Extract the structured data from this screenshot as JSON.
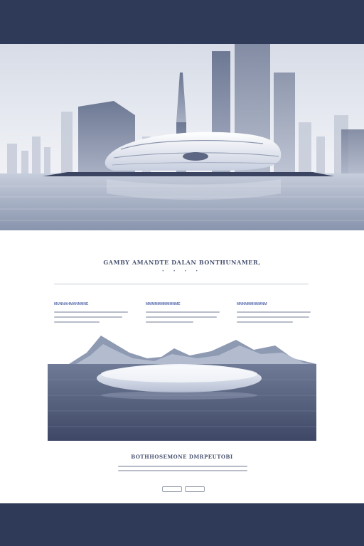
{
  "hero": {
    "scene": "futuristic-building-on-water",
    "colors": {
      "sky": "#e9ecf3",
      "water": "#9ea9c0",
      "building": "#f5f6fa"
    }
  },
  "main": {
    "headline": "GAMBY AMANDTE DALAN BONTHUNAMER,",
    "dots": "• • • •",
    "columns": [
      {
        "title": "MUNNAHMANNMNE",
        "lines": 3
      },
      {
        "title": "MMMMMMMMMNME",
        "lines": 3
      },
      {
        "title": "MNNNMMNNMNM",
        "lines": 3
      }
    ]
  },
  "feature": {
    "scene": "disc-shaped-boat-near-mountains"
  },
  "footer_section": {
    "heading": "BOTHHOSEMONE DMRPEUTOBI",
    "button_1": "",
    "button_2": ""
  },
  "colors": {
    "bar": "#2f3a58",
    "accent": "#5b6fb0",
    "text": "#4a5472"
  }
}
